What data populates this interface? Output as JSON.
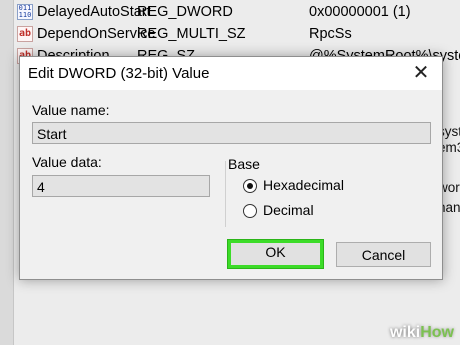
{
  "registry": {
    "rows": [
      {
        "icon": "binary",
        "icon_glyph": "011\n110",
        "name": "DelayedAutoStart",
        "type": "REG_DWORD",
        "data": "0x00000001 (1)"
      },
      {
        "icon": "string",
        "icon_glyph": "ab",
        "name": "DependOnService",
        "type": "REG_MULTI_SZ",
        "data": "RpcSs"
      },
      {
        "icon": "string",
        "icon_glyph": "ab",
        "name": "Description",
        "type": "REG_SZ",
        "data": "@%SystemRoot%\\syste"
      }
    ],
    "right_fragments": [
      "syste",
      "em3",
      "worl",
      "nan"
    ]
  },
  "dialog": {
    "title": "Edit DWORD (32-bit) Value",
    "close_glyph": "✕",
    "value_name_label": "Value name:",
    "value_name": "Start",
    "value_data_label": "Value data:",
    "value_data": "4",
    "base_label": "Base",
    "base_options": [
      {
        "label": "Hexadecimal",
        "checked": true
      },
      {
        "label": "Decimal",
        "checked": false
      }
    ],
    "ok_label": "OK",
    "cancel_label": "Cancel"
  },
  "watermark": {
    "wiki": "wiki",
    "how": "How"
  },
  "colors": {
    "highlight": "#3cdc28",
    "accent_green": "#7cc151"
  }
}
